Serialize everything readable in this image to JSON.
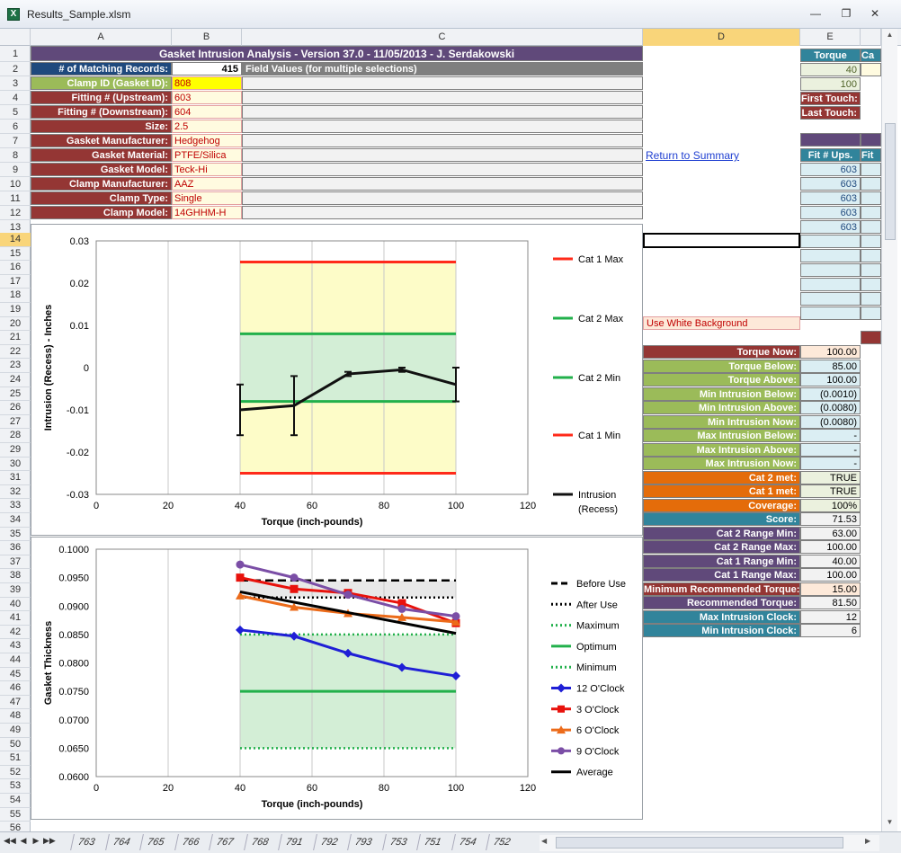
{
  "window": {
    "title": "Results_Sample.xlsm",
    "app_icon": "X"
  },
  "columns": [
    "A",
    "B",
    "C",
    "D",
    "E",
    "Ca"
  ],
  "rows": [
    "1",
    "2",
    "3",
    "4",
    "5",
    "6",
    "7",
    "8",
    "9",
    "10",
    "11",
    "12",
    "13",
    "14",
    "15",
    "16",
    "17",
    "18",
    "19",
    "20",
    "21",
    "22",
    "23",
    "24",
    "25",
    "26",
    "27",
    "28",
    "29",
    "30",
    "31",
    "32",
    "33",
    "34",
    "35",
    "36",
    "37",
    "38",
    "39",
    "40",
    "41",
    "42",
    "43",
    "44",
    "45",
    "46",
    "47",
    "48",
    "49",
    "50",
    "51",
    "52",
    "53",
    "54",
    "55",
    "56"
  ],
  "header": {
    "title": "Gasket Intrusion Analysis - Version 37.0 - 11/05/2013 - J. Serdakowski"
  },
  "matching": {
    "label": "# of Matching Records:",
    "value": "415",
    "field_values": "Field Values (for multiple selections)"
  },
  "fields": [
    {
      "label": "Clamp ID (Gasket ID):",
      "value": "808",
      "color": "#9bbb59"
    },
    {
      "label": "Fitting # (Upstream):",
      "value": "603",
      "color": "#943634"
    },
    {
      "label": "Fitting # (Downstream):",
      "value": "604",
      "color": "#943634"
    },
    {
      "label": "Size:",
      "value": "2.5",
      "color": "#943634"
    },
    {
      "label": "Gasket Manufacturer:",
      "value": "Hedgehog",
      "color": "#943634"
    },
    {
      "label": "Gasket Material:",
      "value": "PTFE/Silica",
      "color": "#943634"
    },
    {
      "label": "Gasket Model:",
      "value": "Teck-Hi",
      "color": "#943634"
    },
    {
      "label": "Clamp Manufacturer:",
      "value": "AAZ",
      "color": "#943634"
    },
    {
      "label": "Clamp Type:",
      "value": "Single",
      "color": "#943634"
    },
    {
      "label": "Clamp Model:",
      "value": "14GHHM-H",
      "color": "#943634"
    }
  ],
  "sidepanel": {
    "return_link": "Return to Summary",
    "white_bg": "Use White Background",
    "torque_header": "Torque",
    "torque_values": [
      "40",
      "100"
    ],
    "first_touch": "First Touch:",
    "last_touch": "Last Touch:",
    "fit_header": "Fit # Ups.",
    "fit_header2": "Fit",
    "fit_values": [
      "603",
      "603",
      "603",
      "603",
      "603"
    ]
  },
  "stats": [
    {
      "label": "Torque Now:",
      "value": "100.00",
      "color": "#943634",
      "val_bg": "#fde9d9"
    },
    {
      "label": "Torque Below:",
      "value": "85.00",
      "color": "#9bbb59",
      "val_bg": "#dbeef3"
    },
    {
      "label": "Torque Above:",
      "value": "100.00",
      "color": "#9bbb59",
      "val_bg": "#dbeef3"
    },
    {
      "label": "Min Intrusion Below:",
      "value": "(0.0010)",
      "color": "#9bbb59",
      "val_bg": "#dbeef3"
    },
    {
      "label": "Min Intrusion Above:",
      "value": "(0.0080)",
      "color": "#9bbb59",
      "val_bg": "#dbeef3"
    },
    {
      "label": "Min Intrusion Now:",
      "value": "(0.0080)",
      "color": "#9bbb59",
      "val_bg": "#dbeef3"
    },
    {
      "label": "Max Intrusion Below:",
      "value": "-",
      "color": "#9bbb59",
      "val_bg": "#dbeef3"
    },
    {
      "label": "Max Intrusion Above:",
      "value": "-",
      "color": "#9bbb59",
      "val_bg": "#dbeef3"
    },
    {
      "label": "Max Intrusion Now:",
      "value": "-",
      "color": "#9bbb59",
      "val_bg": "#dbeef3"
    },
    {
      "label": "Cat 2 met:",
      "value": "TRUE",
      "color": "#e46c0a",
      "val_bg": "#ebf1de"
    },
    {
      "label": "Cat 1 met:",
      "value": "TRUE",
      "color": "#e46c0a",
      "val_bg": "#ebf1de"
    },
    {
      "label": "Coverage:",
      "value": "100%",
      "color": "#e46c0a",
      "val_bg": "#ebf1de"
    },
    {
      "label": "Score:",
      "value": "71.53",
      "color": "#31849b",
      "val_bg": "#f2f2f2"
    },
    {
      "label": "Cat 2 Range Min:",
      "value": "63.00",
      "color": "#60497a",
      "val_bg": "#f2f2f2"
    },
    {
      "label": "Cat 2 Range Max:",
      "value": "100.00",
      "color": "#60497a",
      "val_bg": "#f2f2f2"
    },
    {
      "label": "Cat 1 Range Min:",
      "value": "40.00",
      "color": "#60497a",
      "val_bg": "#f2f2f2"
    },
    {
      "label": "Cat 1 Range Max:",
      "value": "100.00",
      "color": "#60497a",
      "val_bg": "#f2f2f2"
    },
    {
      "label": "Minimum Recommended Torque:",
      "value": "15.00",
      "color": "#943634",
      "val_bg": "#fde9d9"
    },
    {
      "label": "Recommended Torque:",
      "value": "81.50",
      "color": "#60497a",
      "val_bg": "#f2f2f2"
    },
    {
      "label": "Max Intrusion Clock:",
      "value": "12",
      "color": "#31849b",
      "val_bg": "#f2f2f2"
    },
    {
      "label": "Min Intrusion Clock:",
      "value": "6",
      "color": "#31849b",
      "val_bg": "#f2f2f2"
    }
  ],
  "sheet_tabs": [
    "763",
    "764",
    "765",
    "766",
    "767",
    "768",
    "791",
    "792",
    "793",
    "753",
    "751",
    "754",
    "752"
  ],
  "chart_data": [
    {
      "type": "line",
      "xlabel": "Torque (inch-pounds)",
      "ylabel": "Intrusion (Recess) - Inches",
      "xlim": [
        0,
        120
      ],
      "ylim": [
        -0.03,
        0.03
      ],
      "xticks": [
        "0",
        "20",
        "40",
        "60",
        "80",
        "100",
        "120"
      ],
      "yticks": [
        "0.03",
        "0.02",
        "0.01",
        "0",
        "-0.01",
        "-0.02",
        "-0.03"
      ],
      "bands": [
        {
          "from": -0.025,
          "to": 0.025,
          "x0": 40,
          "x1": 100,
          "color": "#fde0e0"
        },
        {
          "from": -0.025,
          "to": 0.025,
          "x0": 40,
          "x1": 100,
          "color": "#fdfcc8",
          "inset": true
        },
        {
          "from": -0.008,
          "to": 0.008,
          "x0": 40,
          "x1": 100,
          "color": "#d3eed6"
        }
      ],
      "series": [
        {
          "name": "Cat 1 Max",
          "color": "#ff2a1a",
          "x": [
            40,
            100
          ],
          "y": [
            0.025,
            0.025
          ]
        },
        {
          "name": "Cat 2 Max",
          "color": "#22b04b",
          "x": [
            40,
            100
          ],
          "y": [
            0.008,
            0.008
          ]
        },
        {
          "name": "Cat 2 Min",
          "color": "#22b04b",
          "x": [
            40,
            100
          ],
          "y": [
            -0.008,
            -0.008
          ]
        },
        {
          "name": "Cat 1 Min",
          "color": "#ff2a1a",
          "x": [
            40,
            100
          ],
          "y": [
            -0.025,
            -0.025
          ]
        },
        {
          "name": "Intrusion (Recess)",
          "color": "#111111",
          "x": [
            40,
            55,
            70,
            85,
            100
          ],
          "y": [
            -0.01,
            -0.009,
            -0.0015,
            -0.0005,
            -0.004
          ],
          "err_low": [
            -0.016,
            -0.016,
            -0.002,
            -0.001,
            -0.008
          ],
          "err_high": [
            -0.004,
            -0.002,
            -0.001,
            0.0,
            0.0
          ]
        }
      ]
    },
    {
      "type": "line",
      "xlabel": "Torque (inch-pounds)",
      "ylabel": "Gasket Thickness",
      "xlim": [
        0,
        120
      ],
      "ylim": [
        0.06,
        0.1
      ],
      "xticks": [
        "0",
        "20",
        "40",
        "60",
        "80",
        "100",
        "120"
      ],
      "yticks": [
        "0.1000",
        "0.0950",
        "0.0900",
        "0.0850",
        "0.0800",
        "0.0750",
        "0.0700",
        "0.0650",
        "0.0600"
      ],
      "bands": [
        {
          "from": 0.065,
          "to": 0.085,
          "x0": 40,
          "x1": 100,
          "color": "#d3eed6"
        },
        {
          "from": 0.0915,
          "to": 0.0945,
          "x0": 40,
          "x1": 100,
          "color": "#e8e8e8"
        }
      ],
      "series": [
        {
          "name": "Before Use",
          "color": "#000000",
          "style": "dash",
          "x": [
            40,
            100
          ],
          "y": [
            0.0945,
            0.0945
          ]
        },
        {
          "name": "After Use",
          "color": "#000000",
          "style": "dot",
          "x": [
            40,
            100
          ],
          "y": [
            0.0915,
            0.0915
          ]
        },
        {
          "name": "Maximum",
          "color": "#22b04b",
          "style": "dot",
          "x": [
            40,
            100
          ],
          "y": [
            0.085,
            0.085
          ]
        },
        {
          "name": "Optimum",
          "color": "#22b04b",
          "x": [
            40,
            100
          ],
          "y": [
            0.075,
            0.075
          ]
        },
        {
          "name": "Minimum",
          "color": "#22b04b",
          "style": "dot",
          "x": [
            40,
            100
          ],
          "y": [
            0.065,
            0.065
          ]
        },
        {
          "name": "12 O'Clock",
          "color": "#1f1fd6",
          "marker": "diamond",
          "x": [
            40,
            55,
            70,
            85,
            100
          ],
          "y": [
            0.0858,
            0.0847,
            0.0817,
            0.0792,
            0.0777
          ]
        },
        {
          "name": "3 O'Clock",
          "color": "#e8120c",
          "marker": "square",
          "x": [
            40,
            55,
            70,
            85,
            100
          ],
          "y": [
            0.095,
            0.093,
            0.0923,
            0.0905,
            0.087
          ]
        },
        {
          "name": "6 O'Clock",
          "color": "#ec6b1a",
          "marker": "triangle",
          "x": [
            40,
            55,
            70,
            85,
            100
          ],
          "y": [
            0.0918,
            0.0898,
            0.0887,
            0.088,
            0.0872
          ]
        },
        {
          "name": "9 O'Clock",
          "color": "#7b4ea6",
          "marker": "circle",
          "x": [
            40,
            55,
            70,
            85,
            100
          ],
          "y": [
            0.0973,
            0.095,
            0.092,
            0.0895,
            0.0882
          ]
        },
        {
          "name": "Average",
          "color": "#000000",
          "x": [
            40,
            100
          ],
          "y": [
            0.0925,
            0.0852
          ]
        }
      ]
    }
  ]
}
